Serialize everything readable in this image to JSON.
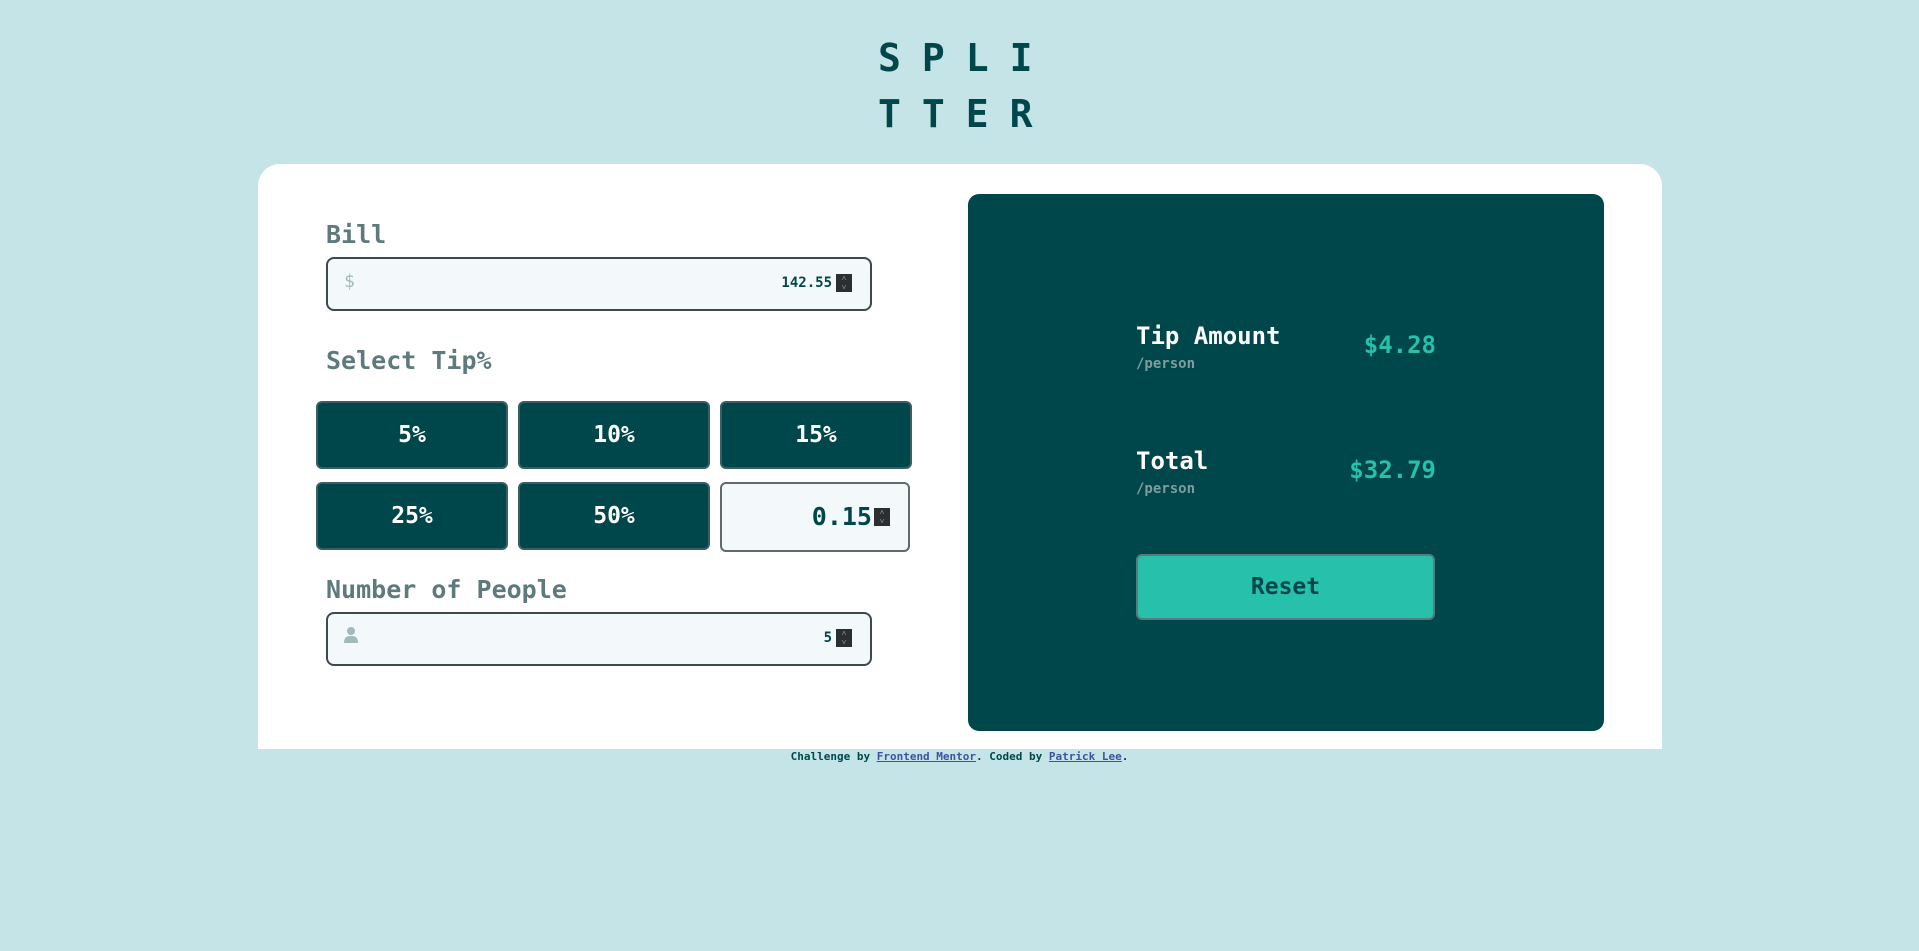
{
  "logo": {
    "line1": "SPLI",
    "line2": "TTER"
  },
  "form": {
    "bill_label": "Bill",
    "bill_icon": "$",
    "bill_value": "142.55",
    "tip_label": "Select Tip%",
    "tips": [
      "5%",
      "10%",
      "15%",
      "25%",
      "50%"
    ],
    "custom_tip_value": "0.15",
    "people_label": "Number of People",
    "people_icon": "person-icon",
    "people_value": "5"
  },
  "result": {
    "tip_label": "Tip Amount",
    "tip_sub": "/person",
    "tip_value": "$4.28",
    "total_label": "Total",
    "total_sub": "/person",
    "total_value": "$32.79",
    "reset_label": "Reset"
  },
  "footer": {
    "prefix": "Challenge by ",
    "link1": "Frontend Mentor",
    "middle": ". Coded by ",
    "link2": "Patrick Lee",
    "suffix": "."
  },
  "colors": {
    "background": "#c5e4e7",
    "dark_cyan": "#00474b",
    "accent": "#26c0ab",
    "grey": "#5e7a7d"
  }
}
